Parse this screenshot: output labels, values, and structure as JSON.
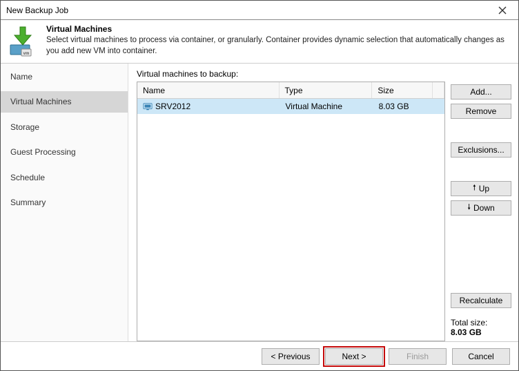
{
  "window": {
    "title": "New Backup Job"
  },
  "header": {
    "title": "Virtual Machines",
    "description": "Select virtual machines to process via container, or granularly. Container provides dynamic selection that automatically changes as you add new VM into container."
  },
  "sidebar": {
    "items": [
      {
        "label": "Name",
        "active": false
      },
      {
        "label": "Virtual Machines",
        "active": true
      },
      {
        "label": "Storage",
        "active": false
      },
      {
        "label": "Guest Processing",
        "active": false
      },
      {
        "label": "Schedule",
        "active": false
      },
      {
        "label": "Summary",
        "active": false
      }
    ]
  },
  "listLabel": "Virtual machines to backup:",
  "columns": {
    "name": "Name",
    "type": "Type",
    "size": "Size"
  },
  "rows": [
    {
      "name": "SRV2012",
      "type": "Virtual Machine",
      "size": "8.03 GB"
    }
  ],
  "buttons": {
    "add": "Add...",
    "remove": "Remove",
    "exclusions": "Exclusions...",
    "up": "Up",
    "down": "Down",
    "recalculate": "Recalculate"
  },
  "totals": {
    "label": "Total size:",
    "value": "8.03 GB"
  },
  "footer": {
    "previous": "< Previous",
    "next": "Next >",
    "finish": "Finish",
    "cancel": "Cancel"
  }
}
